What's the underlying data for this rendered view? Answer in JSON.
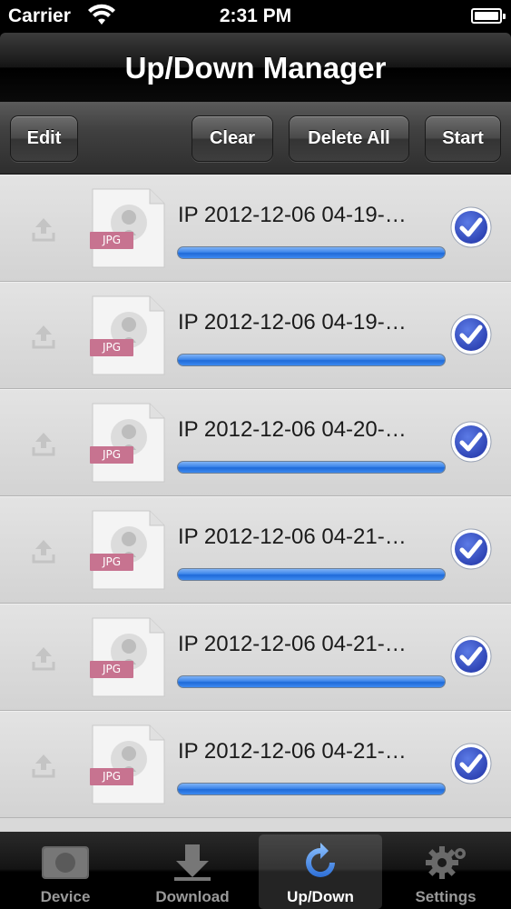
{
  "status_bar": {
    "carrier": "Carrier",
    "time": "2:31 PM"
  },
  "nav": {
    "title": "Up/Down Manager"
  },
  "toolbar": {
    "edit_label": "Edit",
    "clear_label": "Clear",
    "delete_all_label": "Delete All",
    "start_label": "Start"
  },
  "transfers": [
    {
      "name": "IP 2012-12-06 04-19-…",
      "type": "JPG",
      "progress": 1.0,
      "done": true
    },
    {
      "name": "IP 2012-12-06 04-19-…",
      "type": "JPG",
      "progress": 1.0,
      "done": true
    },
    {
      "name": "IP 2012-12-06 04-20-…",
      "type": "JPG",
      "progress": 1.0,
      "done": true
    },
    {
      "name": "IP 2012-12-06 04-21-…",
      "type": "JPG",
      "progress": 1.0,
      "done": true
    },
    {
      "name": "IP 2012-12-06 04-21-…",
      "type": "JPG",
      "progress": 1.0,
      "done": true
    },
    {
      "name": "IP 2012-12-06 04-21-…",
      "type": "JPG",
      "progress": 1.0,
      "done": true
    }
  ],
  "tabs": [
    {
      "label": "Device",
      "icon": "camera-icon"
    },
    {
      "label": "Download",
      "icon": "download-icon"
    },
    {
      "label": "Up/Down",
      "icon": "sync-icon",
      "active": true
    },
    {
      "label": "Settings",
      "icon": "gear-icon"
    }
  ],
  "colors": {
    "progress": "#2f7be6",
    "check": "#3a55c8",
    "jpg_tag": "#c77390"
  }
}
